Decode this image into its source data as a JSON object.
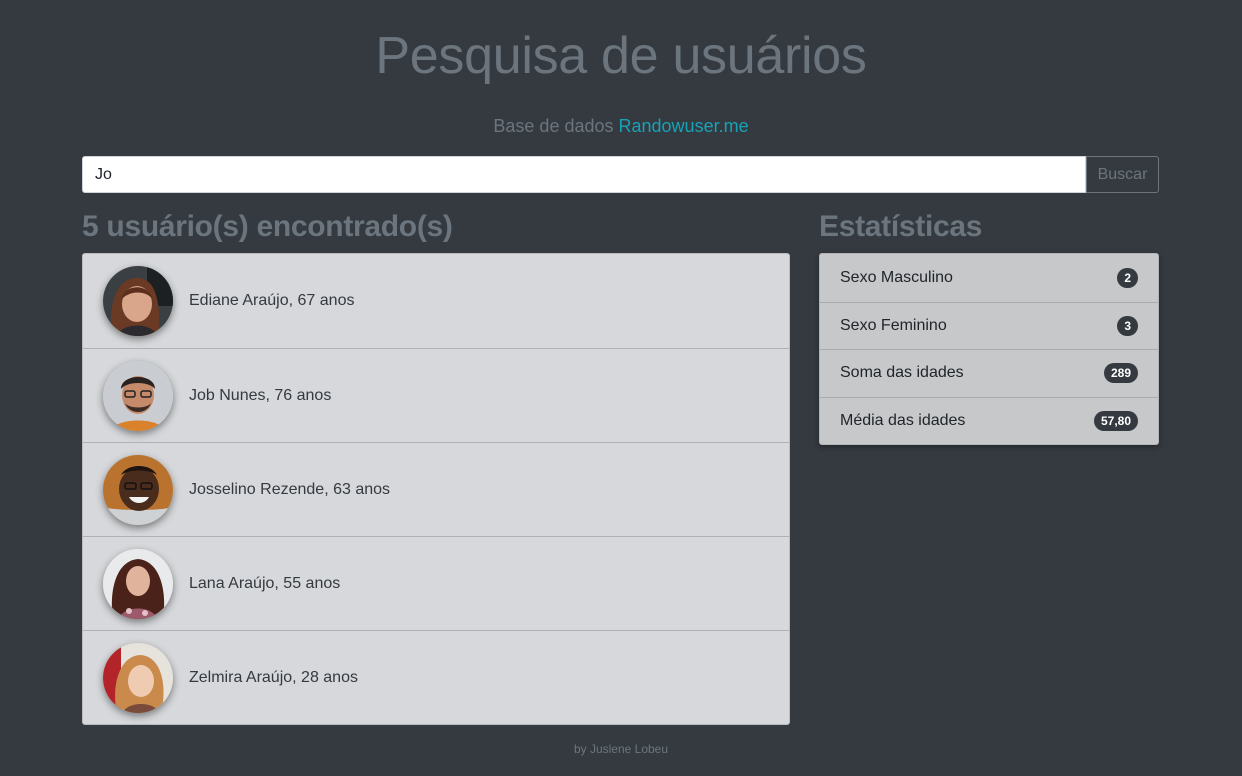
{
  "header": {
    "title": "Pesquisa de usuários",
    "subtitle_prefix": "Base de dados",
    "subtitle_link": "Randowuser.me",
    "link_color": "#17a2b8"
  },
  "search": {
    "value": "Jo",
    "button_label": "Buscar"
  },
  "results": {
    "heading": "5 usuário(s) encontrado(s)",
    "users": [
      {
        "label": "Ediane Araújo, 67 anos",
        "avatar": "user-avatar-photo"
      },
      {
        "label": "Job Nunes, 76 anos",
        "avatar": "user-avatar-photo"
      },
      {
        "label": "Josselino Rezende, 63 anos",
        "avatar": "user-avatar-photo"
      },
      {
        "label": "Lana Araújo, 55 anos",
        "avatar": "user-avatar-photo"
      },
      {
        "label": "Zelmira Araújo, 28 anos",
        "avatar": "user-avatar-photo"
      }
    ]
  },
  "stats": {
    "heading": "Estatísticas",
    "items": [
      {
        "label": "Sexo Masculino",
        "value": "2"
      },
      {
        "label": "Sexo Feminino",
        "value": "3"
      },
      {
        "label": "Soma das idades",
        "value": "289"
      },
      {
        "label": "Média das idades",
        "value": "57,80"
      }
    ]
  },
  "footer": {
    "text": "by Juslene Lobeu"
  },
  "colors": {
    "background": "#343a40",
    "muted_text": "#6c757d",
    "list_bg": "#d6d8db",
    "stats_bg": "#c6c8ca",
    "badge_bg": "#343a40"
  }
}
